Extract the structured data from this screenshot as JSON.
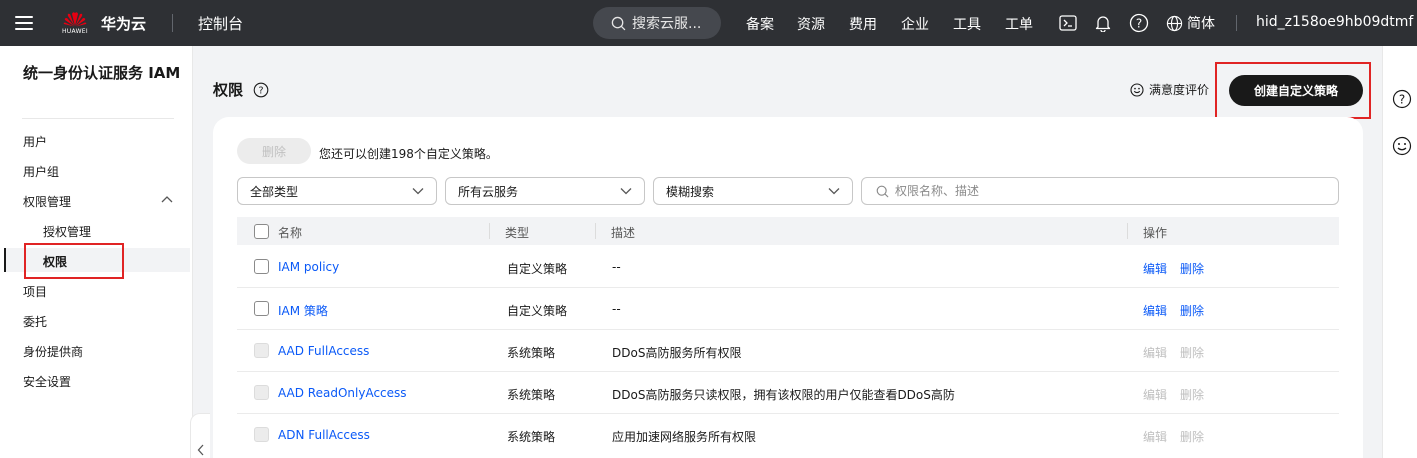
{
  "topbar": {
    "logo_text": "HUAWEI",
    "brand": "华为云",
    "console": "控制台",
    "search_label": "搜索云服...",
    "nav": [
      "备案",
      "资源",
      "费用",
      "企业",
      "工具",
      "工单"
    ],
    "language": "简体",
    "username": "hid_z158oe9hb09dtmf"
  },
  "sidebar": {
    "title": "统一身份认证服务 IAM",
    "items": {
      "users": "用户",
      "user_groups": "用户组",
      "permission_mgmt": "权限管理",
      "authorization": "授权管理",
      "permissions": "权限",
      "projects": "项目",
      "agencies": "委托",
      "identity_providers": "身份提供商",
      "security_settings": "安全设置"
    }
  },
  "page": {
    "title": "权限",
    "satisfaction": "满意度评价",
    "create_button": "创建自定义策略",
    "delete_button": "删除",
    "quota_text": "您还可以创建198个自定义策略。"
  },
  "filters": {
    "type_select": "全部类型",
    "service_select": "所有云服务",
    "search_mode": "模糊搜索",
    "search_placeholder": "权限名称、描述"
  },
  "table": {
    "headers": {
      "name": "名称",
      "type": "类型",
      "description": "描述",
      "actions": "操作"
    },
    "rows": [
      {
        "name": "IAM policy",
        "type": "自定义策略",
        "description": "--",
        "edit": "编辑",
        "delete": "删除",
        "enabled": true
      },
      {
        "name": "IAM 策略",
        "type": "自定义策略",
        "description": "--",
        "edit": "编辑",
        "delete": "删除",
        "enabled": true
      },
      {
        "name": "AAD FullAccess",
        "type": "系统策略",
        "description": "DDoS高防服务所有权限",
        "edit": "编辑",
        "delete": "删除",
        "enabled": false
      },
      {
        "name": "AAD ReadOnlyAccess",
        "type": "系统策略",
        "description": "DDoS高防服务只读权限，拥有该权限的用户仅能查看DDoS高防",
        "edit": "编辑",
        "delete": "删除",
        "enabled": false
      },
      {
        "name": "ADN FullAccess",
        "type": "系统策略",
        "description": "应用加速网络服务所有权限",
        "edit": "编辑",
        "delete": "删除",
        "enabled": false
      }
    ]
  },
  "colors": {
    "topbar_bg": "#2e3034",
    "link": "#0a59f7",
    "primary_button": "#191919",
    "highlight_box": "#e02424"
  }
}
